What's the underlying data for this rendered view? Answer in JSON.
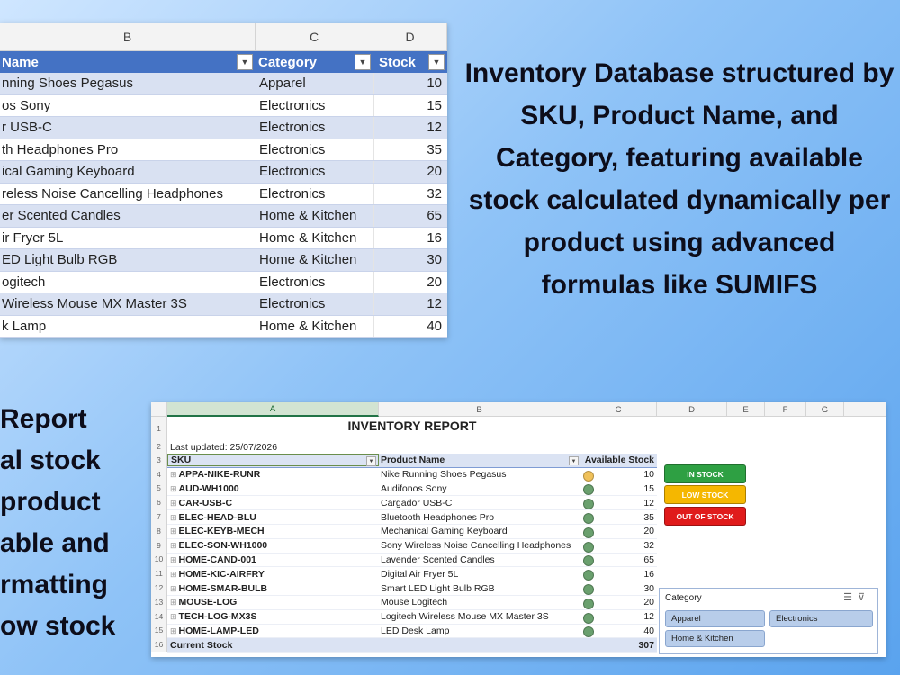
{
  "top_sheet": {
    "col_letters": [
      "B",
      "C",
      "D"
    ],
    "headers": {
      "b": "Name",
      "c": "Category",
      "d": "Stock"
    },
    "rows": [
      {
        "b": "nning Shoes Pegasus",
        "c": "Apparel",
        "d": "10"
      },
      {
        "b": "os Sony",
        "c": "Electronics",
        "d": "15"
      },
      {
        "b": "r USB-C",
        "c": "Electronics",
        "d": "12"
      },
      {
        "b": "th Headphones Pro",
        "c": "Electronics",
        "d": "35"
      },
      {
        "b": "ical Gaming Keyboard",
        "c": "Electronics",
        "d": "20"
      },
      {
        "b": "reless Noise Cancelling Headphones",
        "c": "Electronics",
        "d": "32"
      },
      {
        "b": "er Scented Candles",
        "c": "Home & Kitchen",
        "d": "65"
      },
      {
        "b": "ir Fryer 5L",
        "c": "Home & Kitchen",
        "d": "16"
      },
      {
        "b": "ED Light Bulb RGB",
        "c": "Home & Kitchen",
        "d": "30"
      },
      {
        "b": "ogitech",
        "c": "Electronics",
        "d": "20"
      },
      {
        "b": " Wireless Mouse MX Master 3S",
        "c": "Electronics",
        "d": "12"
      },
      {
        "b": "k Lamp",
        "c": "Home & Kitchen",
        "d": "40"
      }
    ]
  },
  "caption_top": "Inventory Database structured by SKU, Product Name, and Category, featuring available stock calculated dynamically per product using advanced formulas like SUMIFS",
  "caption_left_lines": [
    "Report",
    "al stock",
    "product",
    "able and",
    "rmatting",
    "ow stock"
  ],
  "report": {
    "col_letters": [
      "A",
      "B",
      "C",
      "D",
      "E",
      "F",
      "G"
    ],
    "row_numbers": [
      "1",
      "2",
      "3",
      "4",
      "5",
      "6",
      "7",
      "8",
      "9",
      "10",
      "11",
      "12",
      "13",
      "14",
      "15",
      "16"
    ],
    "title": "INVENTORY REPORT",
    "last_updated": "Last updated: 25/07/2026",
    "headers": {
      "sku": "SKU",
      "name": "Product Name",
      "stock": "Available Stock"
    },
    "rows": [
      {
        "sku": "APPA-NIKE-RUNR",
        "name": "Nike Running Shoes Pegasus",
        "stock": "10",
        "status": "low"
      },
      {
        "sku": "AUD-WH1000",
        "name": "Audifonos Sony",
        "stock": "15",
        "status": "ok"
      },
      {
        "sku": "CAR-USB-C",
        "name": "Cargador USB-C",
        "stock": "12",
        "status": "ok"
      },
      {
        "sku": "ELEC-HEAD-BLU",
        "name": "Bluetooth Headphones Pro",
        "stock": "35",
        "status": "ok"
      },
      {
        "sku": "ELEC-KEYB-MECH",
        "name": "Mechanical Gaming Keyboard",
        "stock": "20",
        "status": "ok"
      },
      {
        "sku": "ELEC-SON-WH1000",
        "name": "Sony Wireless Noise Cancelling Headphones",
        "stock": "32",
        "status": "ok"
      },
      {
        "sku": "HOME-CAND-001",
        "name": "Lavender Scented Candles",
        "stock": "65",
        "status": "ok"
      },
      {
        "sku": "HOME-KIC-AIRFRY",
        "name": "Digital Air Fryer 5L",
        "stock": "16",
        "status": "ok"
      },
      {
        "sku": "HOME-SMAR-BULB",
        "name": "Smart LED Light Bulb RGB",
        "stock": "30",
        "status": "ok"
      },
      {
        "sku": "MOUSE-LOG",
        "name": "Mouse Logitech",
        "stock": "20",
        "status": "ok"
      },
      {
        "sku": "TECH-LOG-MX3S",
        "name": "Logitech Wireless Mouse MX Master 3S",
        "stock": "12",
        "status": "ok"
      },
      {
        "sku": "HOME-LAMP-LED",
        "name": "LED Desk Lamp",
        "stock": "40",
        "status": "ok"
      }
    ],
    "total": {
      "label": "Current Stock",
      "value": "307"
    },
    "legend": {
      "in_stock": "IN STOCK",
      "low_stock": "LOW STOCK",
      "out_of_stock": "OUT OF STOCK"
    },
    "slicer": {
      "title": "Category",
      "items": [
        "Apparel",
        "Electronics",
        "Home & Kitchen"
      ]
    }
  },
  "colors": {
    "table_header_blue": "#4472c4",
    "band_blue": "#d9e1f2",
    "status_ok": "#6aa06e",
    "status_low": "#f0c15a",
    "legend_green": "#2ea043",
    "legend_yellow": "#f5b700",
    "legend_red": "#e01b1b"
  }
}
